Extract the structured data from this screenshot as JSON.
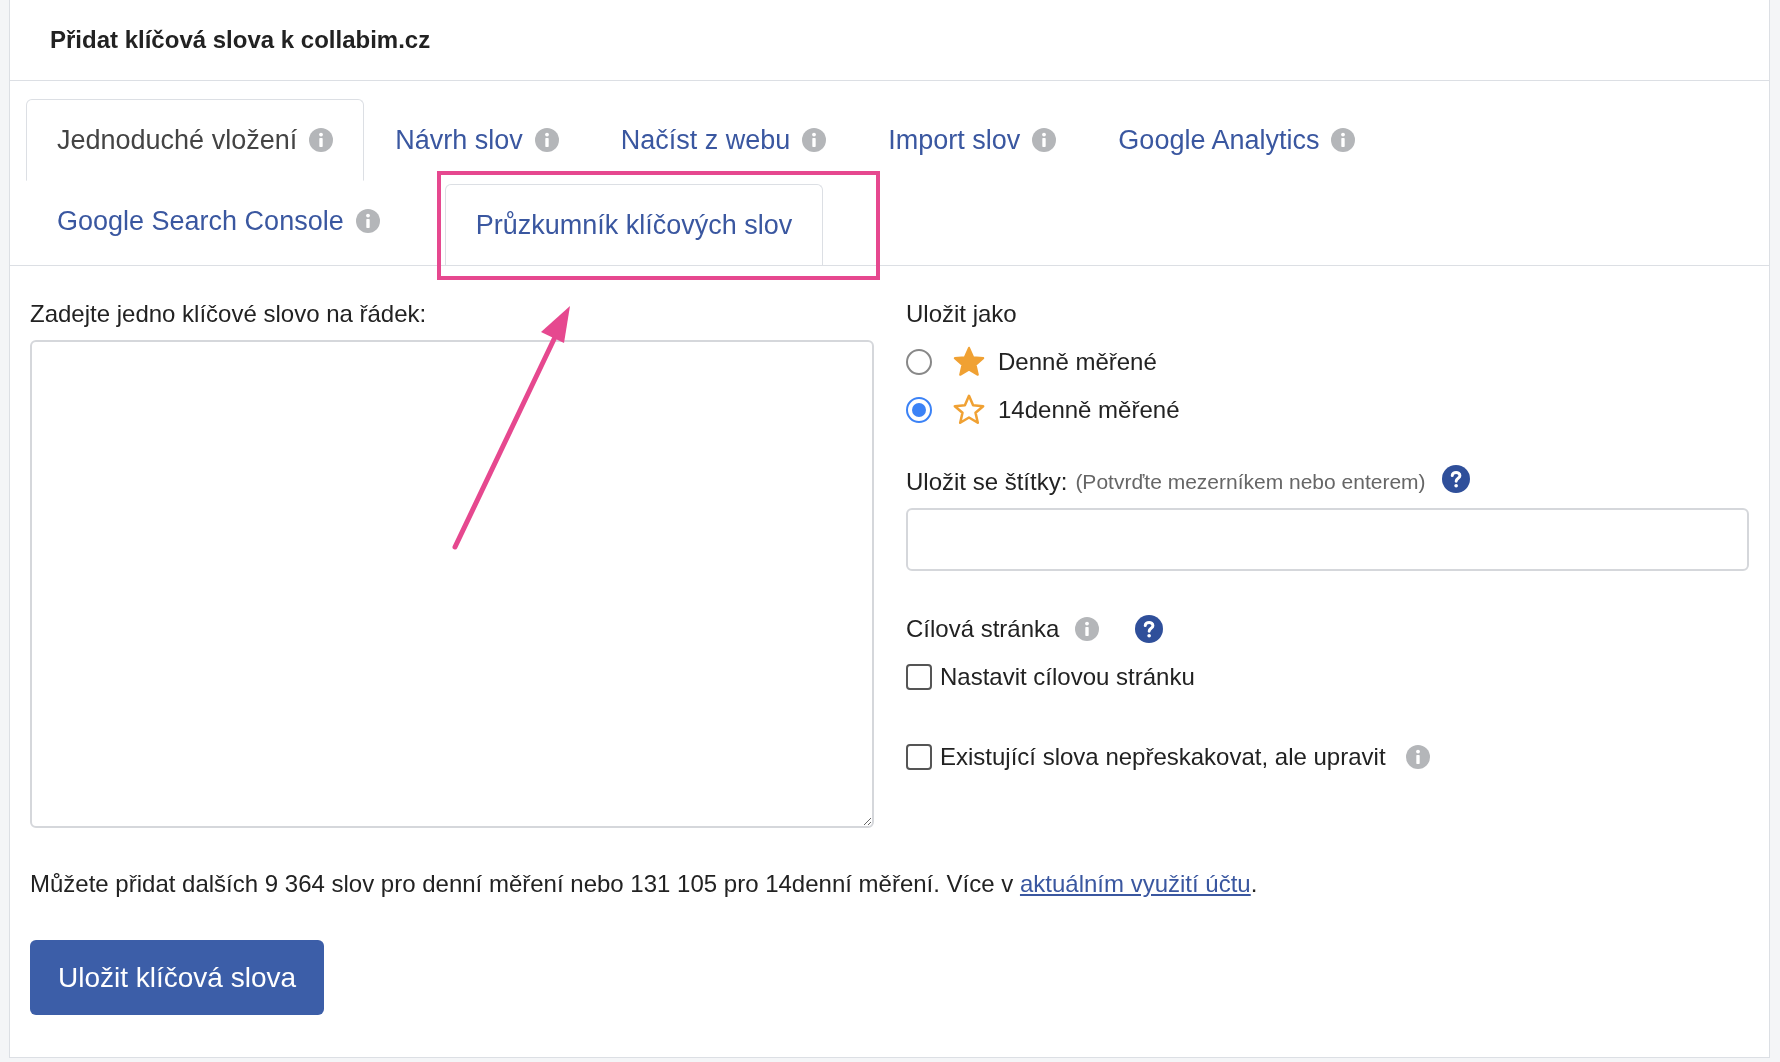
{
  "panel": {
    "title": "Přidat klíčová slova k collabim.cz"
  },
  "tabs": [
    {
      "label": "Jednoduché vložení",
      "selected": true,
      "info": true,
      "highlighted": false
    },
    {
      "label": "Návrh slov",
      "selected": false,
      "info": true,
      "highlighted": false
    },
    {
      "label": "Načíst z webu",
      "selected": false,
      "info": true,
      "highlighted": false
    },
    {
      "label": "Import slov",
      "selected": false,
      "info": true,
      "highlighted": false
    },
    {
      "label": "Google Analytics",
      "selected": false,
      "info": true,
      "highlighted": false
    },
    {
      "label": "Google Search Console",
      "selected": false,
      "info": true,
      "highlighted": false
    },
    {
      "label": "Průzkumník klíčových slov",
      "selected": false,
      "info": false,
      "highlighted": true
    }
  ],
  "keywords": {
    "label": "Zadejte jedno klíčové slovo na řádek:"
  },
  "save_as": {
    "label": "Uložit jako",
    "options": [
      {
        "label": "Denně měřené",
        "selected": false,
        "star_filled": true
      },
      {
        "label": "14denně měřené",
        "selected": true,
        "star_filled": false
      }
    ]
  },
  "tags": {
    "label": "Uložit se štítky:",
    "hint": "(Potvrďte mezerníkem nebo enterem)"
  },
  "target_page": {
    "label": "Cílová stránka",
    "checkbox": {
      "label": "Nastavit cílovou stránku",
      "checked": false
    }
  },
  "overwrite": {
    "label": "Existující slova nepřeskakovat, ale upravit",
    "checked": false
  },
  "note": {
    "text": "Můžete přidat dalších 9 364 slov pro denní měření nebo 131 105 pro 14denní měření. Více v ",
    "link": "aktuálním využití účtu",
    "after": "."
  },
  "submit": "Uložit klíčová slova"
}
